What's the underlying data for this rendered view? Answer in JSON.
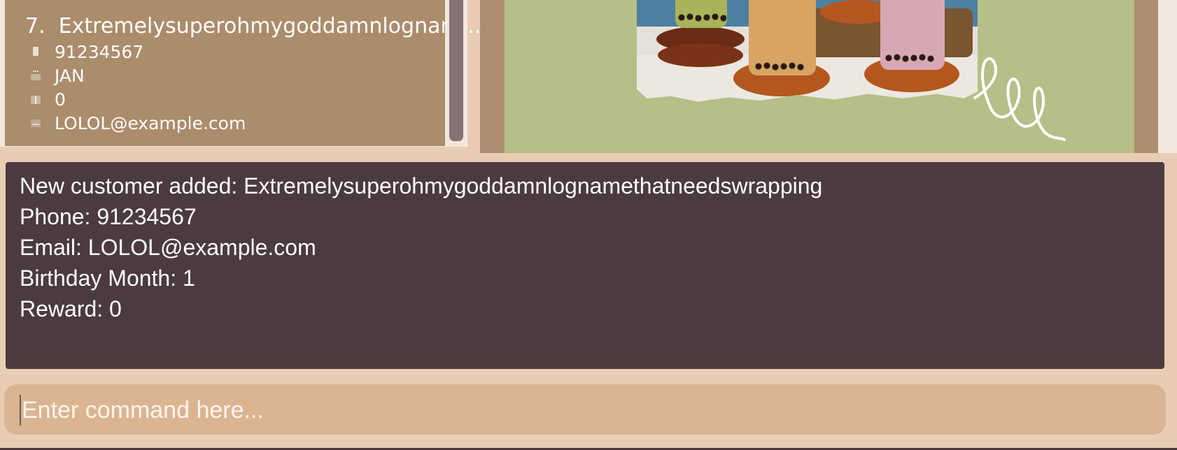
{
  "customer_card": {
    "index": "7.",
    "name": "Extremelysuperohmygoddamnlognam...",
    "phone": "91234567",
    "birthday_month": "JAN",
    "reward_points": "0",
    "email": "LOLOL@example.com",
    "icons": [
      "phone-icon",
      "cake-icon",
      "gift-icon",
      "mail-icon"
    ]
  },
  "result_display": {
    "lines": [
      "New customer added: Extremelysuperohmygoddamnlognamethatneedswrapping",
      "Phone: 91234567",
      "Email: LOLOL@example.com",
      "Birthday Month: 1",
      "Reward: 0"
    ]
  },
  "command_box": {
    "placeholder": "Enter command here..."
  },
  "colors": {
    "app_background": "#e8cdb4",
    "card": "#ab8c6b",
    "result_background": "#4b3b3e",
    "command_background": "#dbb592",
    "image_frame": "#ae8e70",
    "promo_green": "#b5bf87"
  }
}
